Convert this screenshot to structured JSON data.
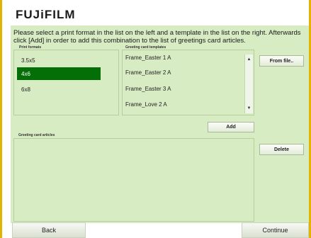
{
  "brand": {
    "logo_text": "FUJiFILM"
  },
  "instructions": "Please select a print format in the list on the left and a template in the list on the right. Afterwards click [Add] in order to add this combination to the list of greetings card articles.",
  "print_formats": {
    "caption": "Print formats",
    "items": [
      "3.5x5",
      "4x6",
      "6x8"
    ],
    "selected_index": 1
  },
  "templates": {
    "caption": "Greeting card templates",
    "items": [
      "Frame_Easter 1 A",
      "Frame_Easter 2 A",
      "Frame_Easter 3 A",
      "Frame_Love 2 A"
    ],
    "scroll_up_icon": "triangle-up-icon",
    "scroll_down_icon": "triangle-down-icon"
  },
  "articles": {
    "caption": "Greeting card articles"
  },
  "buttons": {
    "from_file": "From file..",
    "add": "Add",
    "delete": "Delete",
    "back": "Back",
    "continue": "Continue"
  },
  "colors": {
    "panel": "#d8ecc4",
    "selected": "#046e07",
    "frame_border": "#e0b400"
  }
}
